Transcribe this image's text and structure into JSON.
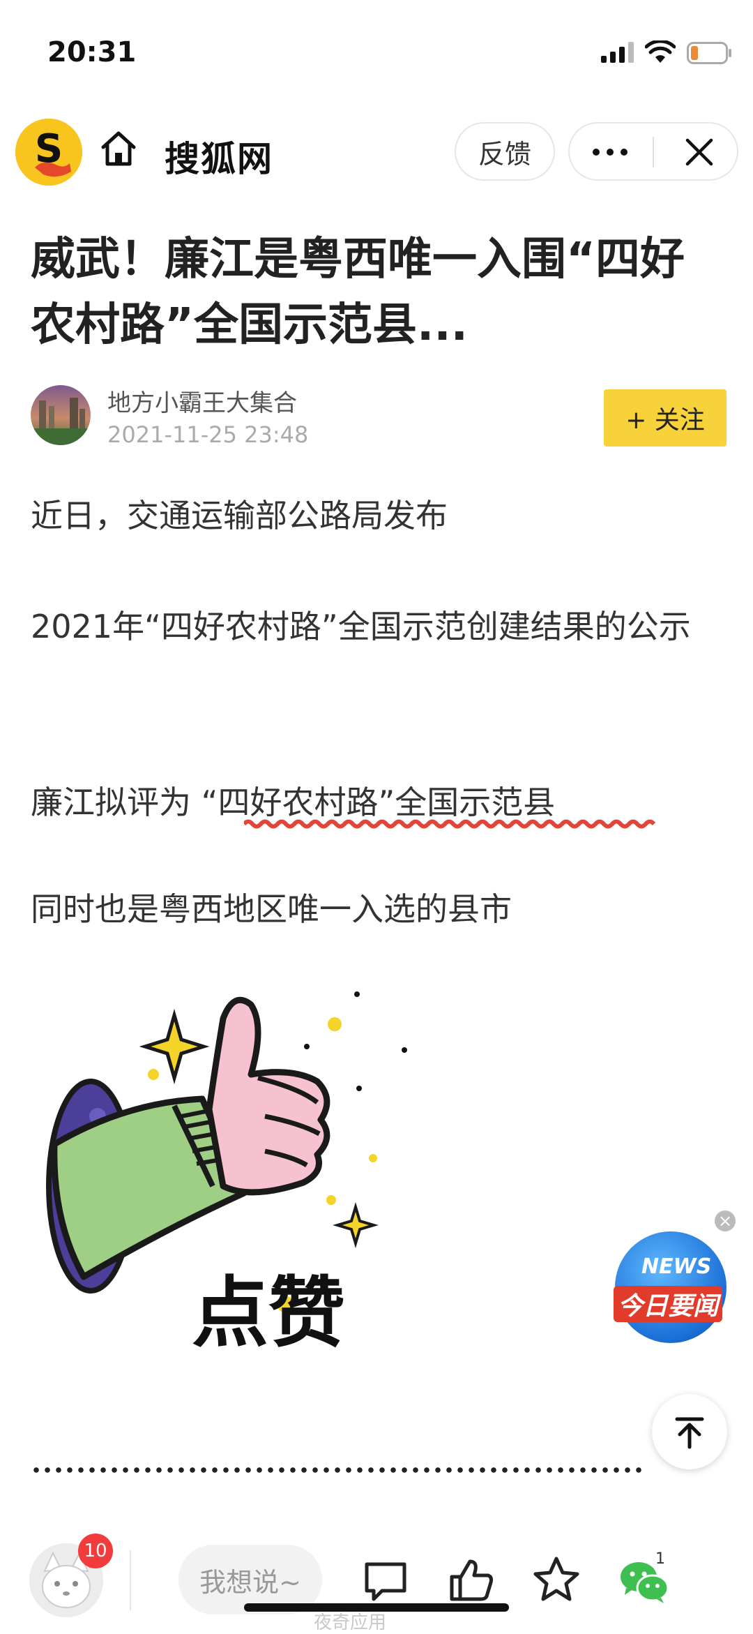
{
  "status_bar": {
    "time": "20:31"
  },
  "nav": {
    "site_name": "搜狐网",
    "logo_letter": "S",
    "feedback_label": "反馈"
  },
  "article": {
    "title": "威武！廉江是粤西唯一入围“四好农村路”全国示范县...",
    "author": "地方小霸王大集合",
    "publish_time": "2021-11-25 23:48",
    "follow_label": "+ 关注",
    "paragraphs": [
      "近日，交通运输部公路局发布",
      "2021年“四好农村路”全国示范创建结果的公示",
      "廉江拟评为 “四好农村路”全国示范县",
      "同时也是粤西地区唯一入选的县市"
    ],
    "image_caption": "点赞"
  },
  "news_badge": {
    "en": "NEWS",
    "cn": "今日要闻"
  },
  "bottom_bar": {
    "notification_count": "10",
    "comment_placeholder": "我想说~",
    "share_count": "1"
  },
  "watermark": "夜奇应用"
}
